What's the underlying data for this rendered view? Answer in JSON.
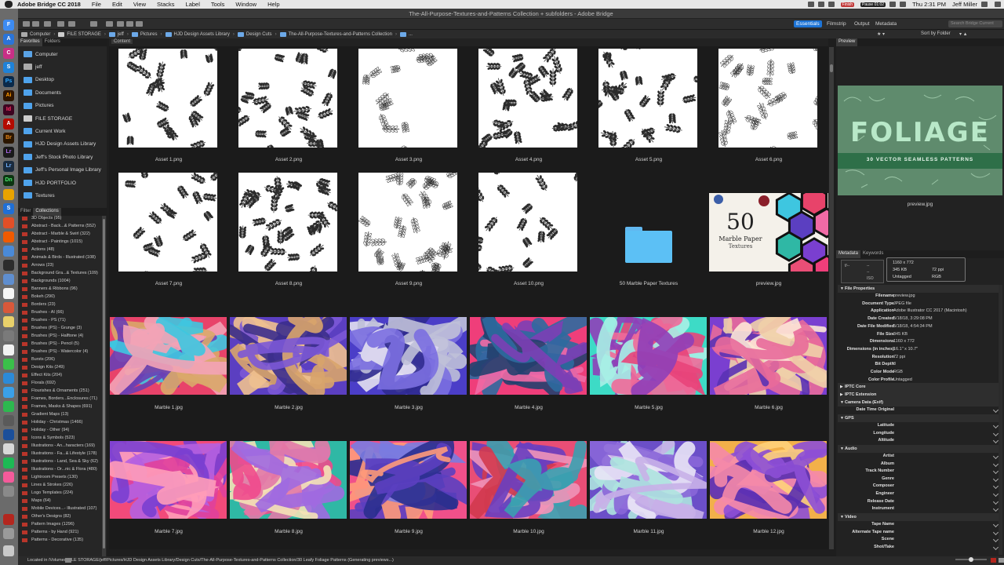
{
  "menubar": {
    "app": "Adobe Bridge CC 2018",
    "items": [
      "File",
      "Edit",
      "View",
      "Stacks",
      "Label",
      "Tools",
      "Window",
      "Help"
    ],
    "tray_finish": "Finish",
    "tray_pause": "Pause 01:02",
    "time": "Thu 2:31 PM",
    "user": "Jeff Miller"
  },
  "window": {
    "title": "The-All-Purpose-Textures-and-Patterns Collection + subfolders - Adobe Bridge",
    "workspaces": [
      "Essentials",
      "Filmstrip",
      "Output",
      "Metadata"
    ],
    "search_placeholder": "Search Bridge Current",
    "sort_label": "Sort by Folder"
  },
  "path": [
    "Computer",
    "FILE STORAGE",
    "jeff",
    "Pictures",
    "HJD Design Assets Library",
    "Design Cuts",
    "The-All-Purpose-Textures-and-Patterns Collection",
    "..."
  ],
  "left": {
    "tabs": [
      "Favorites",
      "Folders"
    ],
    "favorites": [
      "Computer",
      "jeff",
      "Desktop",
      "Documents",
      "Pictures",
      "FILE STORAGE",
      "Current Work",
      "HJD Design Assets Library",
      "Jeff's Stock Photo Library",
      "Jeff's Personal Image Library",
      "HJD PORTFOLIO",
      "Textures"
    ],
    "lower_tabs": [
      "Filter",
      "Collections"
    ],
    "collections": [
      "3D Objects (95)",
      "Abstract - Back...& Patterns (552)",
      "Abstract - Marble & Swirl (322)",
      "Abstract - Paintings (1015)",
      "Actions (48)",
      "Animals & Birds - Illustrated (108)",
      "Arrows (23)",
      "Background Gra...& Textures (109)",
      "Backgrounds (1004)",
      "Banners & Ribbons (96)",
      "Bokeh (290)",
      "Borders (23)",
      "Brushes - AI (66)",
      "Brushes - PS (71)",
      "Brushes (PS) - Grunge (3)",
      "Brushes (PS) - Halftone (4)",
      "Brushes (PS) - Pencil (5)",
      "Brushes (PS) - Watercolor (4)",
      "Bursts (206)",
      "Design Kits (249)",
      "Effect Kits (204)",
      "Florals (692)",
      "Flourishes & Ornaments (251)",
      "Frames, Borders...Enclosures (71)",
      "Frames, Masks & Shapes (691)",
      "Gradient Maps (13)",
      "Holiday - Christmas (1466)",
      "Holiday - Other (94)",
      "Icons & Symbols (523)",
      "Illustrations - An...haracters (169)",
      "Illustrations - Fa...& Lifestyle (178)",
      "Illustrations - Land, Sea & Sky (62)",
      "Illustrations - Or...nic & Flora (480)",
      "Lightroom Presets (130)",
      "Lines & Strokes (226)",
      "Logo Templates (224)",
      "Maps (64)",
      "Mobile Devices...- Illustrated (107)",
      "Other's Designs (82)",
      "Pattern Images (1296)",
      "Patterns - by Hand (921)",
      "Patterns - Decorative (135)"
    ]
  },
  "content": {
    "tab": "Content",
    "items": [
      "Asset 1.png",
      "Asset 2.png",
      "Asset 3.png",
      "Asset 4.png",
      "Asset 5.png",
      "Asset 6.png",
      "Asset 7.png",
      "Asset 8.png",
      "Asset 9.png",
      "Asset 10.png",
      "50 Marble Paper Textures",
      "preview.jpg",
      "Marble 1.jpg",
      "Marble 2.jpg",
      "Marble 3.jpg",
      "Marble 4.jpg",
      "Marble 5.jpg",
      "Marble 6.jpg",
      "Marble 7.jpg",
      "Marble 8.jpg",
      "Marble 9.jpg",
      "Marble 10.jpg",
      "Marble 11.jpg",
      "Marble 12.jpg"
    ],
    "book_cover": {
      "number": "50",
      "line1": "Marble Paper",
      "line2": "Textures"
    }
  },
  "right": {
    "preview_tab": "Preview",
    "preview_title": "FOLIAGE",
    "preview_subtitle": "30 VECTOR SEAMLESS PATTERNS",
    "preview_caption": "preview.jpg",
    "meta_tabs": [
      "Metadata",
      "Keywords"
    ],
    "quick": {
      "dims": "1160 x 772",
      "size": "345 KB",
      "ppi": "72 ppi",
      "tag": "Untagged",
      "mode": "RGB",
      "iso": "ISO"
    },
    "file_properties_title": "File Properties",
    "file_properties": [
      {
        "k": "Filename",
        "v": "preview.jpg"
      },
      {
        "k": "Document Type",
        "v": "JPEG file"
      },
      {
        "k": "Application",
        "v": "Adobe Illustrator CC 2017 (Macintosh)"
      },
      {
        "k": "Date Created",
        "v": "5/18/18, 3:29:08 PM"
      },
      {
        "k": "Date File Modified",
        "v": "5/18/18, 4:54:34 PM"
      },
      {
        "k": "File Size",
        "v": "345 KB"
      },
      {
        "k": "Dimensions",
        "v": "1160 x 772"
      },
      {
        "k": "Dimensions (in inches)",
        "v": "16.1\" x 10.7\""
      },
      {
        "k": "Resolution",
        "v": "72 ppi"
      },
      {
        "k": "Bit Depth",
        "v": "8"
      },
      {
        "k": "Color Mode",
        "v": "RGB"
      },
      {
        "k": "Color Profile",
        "v": "Untagged"
      }
    ],
    "sections": [
      "IPTC Core",
      "IPTC Extension",
      "Camera Data (Exif)",
      "GPS",
      "Audio",
      "Video"
    ],
    "exif_fields": [
      "Date Time Original"
    ],
    "gps_fields": [
      "Latitude",
      "Longitude",
      "Altitude"
    ],
    "audio_fields": [
      "Artist",
      "Album",
      "Track Number",
      "Genre",
      "Composer",
      "Engineer",
      "Release Date",
      "Instrument"
    ],
    "video_fields": [
      "Tape Name",
      "Alternate Tape name",
      "Scene",
      "Shot/Take"
    ]
  },
  "status": "Located in /Volumes/FILE STORAGE/jeff/Pictures/HJD Design Assets Library/Design Cuts/The-All-Purpose-Textures-and-Patterns Collection/30 Leafy Foliage Patterns (Generating previews...)",
  "colors": {
    "accent": "#1d74d6",
    "folder": "#4fa3ec",
    "marble": [
      [
        "#e8436a",
        "#3ec6e0",
        "#f3a3b6",
        "#6a3fb4",
        "#d9a86a"
      ],
      [
        "#5b3fc1",
        "#d8a46b",
        "#7b58d6",
        "#eec08f",
        "#3b2e8c"
      ],
      [
        "#4b3ec8",
        "#bfc0d8",
        "#7b6fe0",
        "#e3e0ef",
        "#2f2a8f"
      ],
      [
        "#ef3e7a",
        "#2d6a9f",
        "#7c3fb5",
        "#f06aa5",
        "#23406e"
      ],
      [
        "#3ddbc6",
        "#e8447a",
        "#8f3fb8",
        "#a7f0e6",
        "#f06a99"
      ],
      [
        "#7a3fd0",
        "#f0d0a8",
        "#e86a9a",
        "#5a32b4",
        "#fde7d6"
      ],
      [
        "#f24a7a",
        "#7a3fd0",
        "#ff9cb8",
        "#e0409b",
        "#b560e0"
      ],
      [
        "#2fb8a5",
        "#ef4a8c",
        "#a06ae0",
        "#f4e2b6",
        "#e27aa7"
      ],
      [
        "#f0508a",
        "#5b3fc0",
        "#ff9a7a",
        "#7a7be0",
        "#2b2f8f"
      ],
      [
        "#e94e76",
        "#6a3fc0",
        "#3aa0b0",
        "#f094b8",
        "#d23a4f"
      ],
      [
        "#6b4fc8",
        "#aee3df",
        "#c8b0e8",
        "#8a66d8",
        "#e9e4f6"
      ],
      [
        "#f2b04a",
        "#8d4fd6",
        "#f58aa8",
        "#ffd27a",
        "#5a2fb0"
      ]
    ]
  }
}
